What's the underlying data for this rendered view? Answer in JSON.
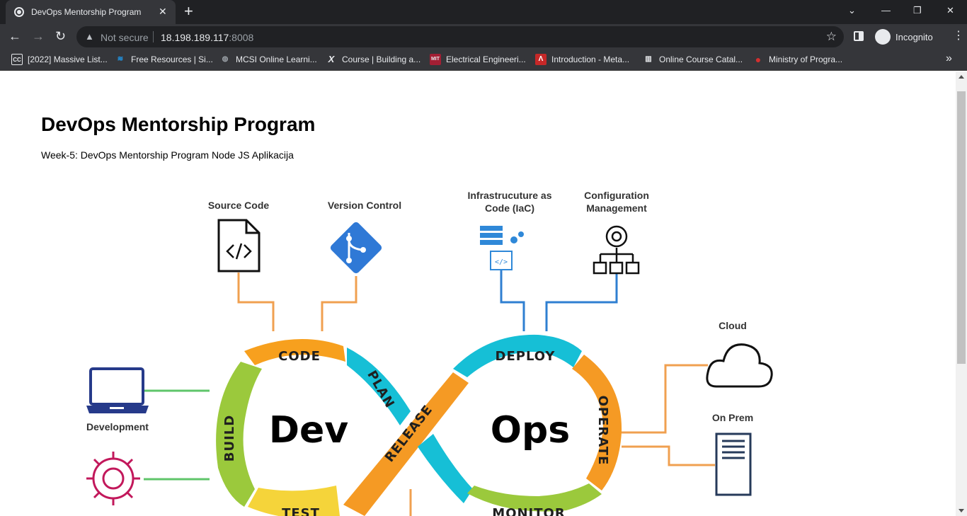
{
  "browser": {
    "tab": {
      "title": "DevOps Mentorship Program",
      "close": "✕"
    },
    "new_tab": "+",
    "window_controls": {
      "minimize": "—",
      "restore": "❐",
      "close": "✕",
      "tab_search": "⌄"
    },
    "nav": {
      "back": "←",
      "forward": "→",
      "reload": "↻"
    },
    "address": {
      "security": "Not secure",
      "host": "18.198.189.117",
      "port": ":8008"
    },
    "star": "☆",
    "profile": "Incognito",
    "menu": "⋮",
    "bookmarks_more": "»",
    "bookmarks": [
      {
        "label": "[2022] Massive List...",
        "icon": "cc-icon",
        "icon_text": "CC",
        "color": "#3c6db5"
      },
      {
        "label": "Free Resources | Si...",
        "icon": "fr-icon",
        "icon_text": "≋",
        "color": "#1f9cf0"
      },
      {
        "label": "MCSI Online Learni...",
        "icon": "globe-icon",
        "icon_text": "◍",
        "color": "#9aa0a6"
      },
      {
        "label": "Course | Building a...",
        "icon": "x-icon",
        "icon_text": "X",
        "color": "#202124"
      },
      {
        "label": "Electrical Engineeri...",
        "icon": "mit-icon",
        "icon_text": "MIT",
        "color": "#a31f34"
      },
      {
        "label": "Introduction - Meta...",
        "icon": "meta-icon",
        "icon_text": "Λ",
        "color": "#c62828"
      },
      {
        "label": "Online Course Catal...",
        "icon": "cisco-icon",
        "icon_text": "▥",
        "color": "#e8eaed"
      },
      {
        "label": "Ministry of Progra...",
        "icon": "mop-icon",
        "icon_text": "●",
        "color": "#d32f2f"
      }
    ]
  },
  "page": {
    "title": "DevOps Mentorship Program",
    "subtitle": "Week-5: DevOps Mentorship Program Node JS Aplikacija"
  },
  "diagram": {
    "labels": {
      "source_code": "Source Code",
      "version_control": "Version Control",
      "iac_line1": "Infrastrucuture as",
      "iac_line2": "Code (IaC)",
      "config_line1": "Configuration",
      "config_line2": "Management",
      "cloud": "Cloud",
      "on_prem": "On Prem",
      "development": "Development"
    },
    "segments": {
      "code": "CODE",
      "plan": "PLAN",
      "build": "BUILD",
      "test": "TEST",
      "release": "RELEASE",
      "deploy": "DEPLOY",
      "operate": "OPERATE",
      "monitor": "MONITOR"
    },
    "center_left": "Dev",
    "center_right": "Ops",
    "colors": {
      "code": "#f7a01e",
      "plan": "#16bfd6",
      "build": "#9bc93c",
      "test": "#f5d43a",
      "release": "#f59a24",
      "deploy": "#16bfd6",
      "operate": "#f59a24",
      "monitor": "#9bc93c",
      "orange_line": "#f0a050",
      "blue_line": "#2f7fd1",
      "green_line": "#5fc56a",
      "git": "#2f79d6",
      "laptop": "#263a8a",
      "cycle": "#c2185b"
    }
  }
}
